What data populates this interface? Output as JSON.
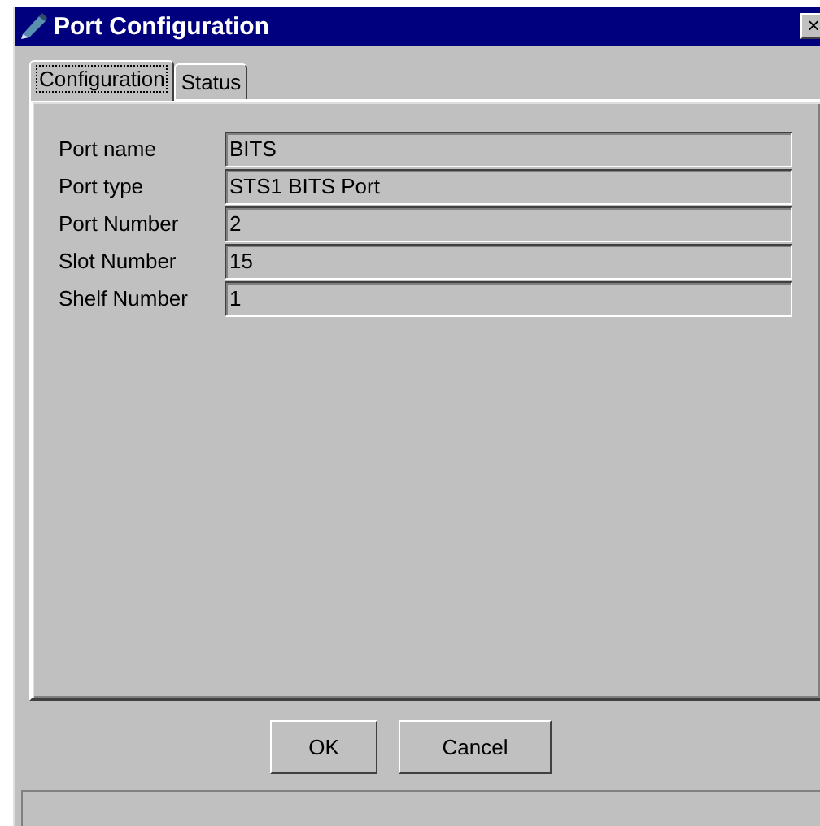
{
  "window": {
    "title": "Port Configuration",
    "close": "×"
  },
  "tabs": [
    {
      "label": "Configuration",
      "selected": true
    },
    {
      "label": "Status",
      "selected": false
    }
  ],
  "fields": [
    {
      "label": "Port name",
      "value": "BITS"
    },
    {
      "label": "Port type",
      "value": "STS1 BITS Port"
    },
    {
      "label": "Port Number",
      "value": "2"
    },
    {
      "label": "Slot Number",
      "value": "15"
    },
    {
      "label": "Shelf Number",
      "value": "1"
    }
  ],
  "buttons": [
    "OK",
    "Cancel"
  ]
}
